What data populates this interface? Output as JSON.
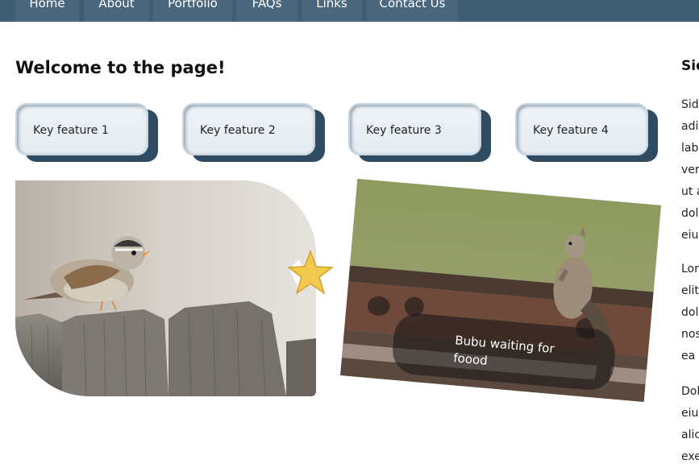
{
  "nav": {
    "items": [
      {
        "label": "Home"
      },
      {
        "label": "About"
      },
      {
        "label": "Portfolio"
      },
      {
        "label": "FAQs"
      },
      {
        "label": "Links"
      },
      {
        "label": "Contact Us"
      }
    ]
  },
  "main": {
    "title": "Welcome to the page!",
    "features": [
      {
        "label": "Key feature 1"
      },
      {
        "label": "Key feature 2"
      },
      {
        "label": "Key feature 3"
      },
      {
        "label": "Key feature 4"
      }
    ],
    "caption": "Bubu waiting for foood"
  },
  "sidebar": {
    "title": "Sid",
    "paragraphs": [
      [
        "Sid",
        "adi",
        "lab",
        "ver",
        "ut a",
        "dol",
        "eiu"
      ],
      [
        "Lor",
        "elit",
        "dol",
        "nos",
        "ea c"
      ],
      [
        "Dol",
        "eiu",
        "alic",
        "exe"
      ]
    ]
  },
  "colors": {
    "nav_bg": "#3f5d73",
    "nav_item_bg": "#4a677d",
    "card_shadow": "#2f4b61",
    "card_bg": "#e8eff4",
    "star": "#f2c94c"
  },
  "icons": {
    "star_badge": "star-icon"
  }
}
